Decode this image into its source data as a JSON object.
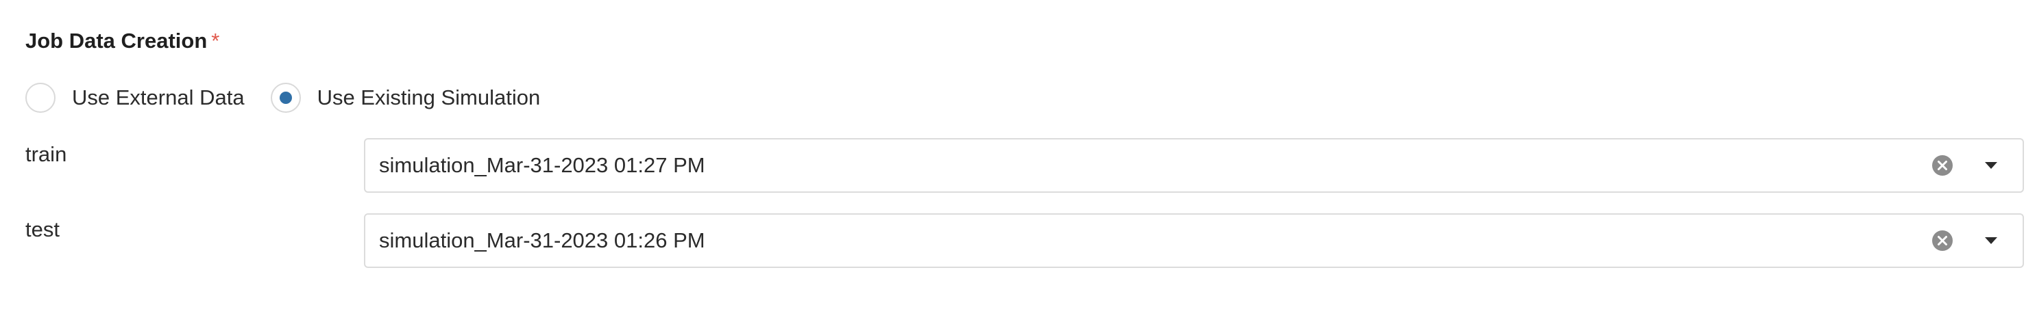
{
  "section": {
    "title": "Job Data Creation",
    "required_mark": "*"
  },
  "data_source": {
    "options": [
      {
        "label": "Use External Data",
        "selected": false
      },
      {
        "label": "Use Existing Simulation",
        "selected": true
      }
    ]
  },
  "fields": {
    "train": {
      "label": "train",
      "value": "simulation_Mar-31-2023 01:27 PM"
    },
    "test": {
      "label": "test",
      "value": "simulation_Mar-31-2023 01:26 PM"
    }
  },
  "colors": {
    "accent": "#2f6fa7",
    "required": "#e0584b",
    "border": "#dcdcdc",
    "icon_gray": "#8c8c8c"
  },
  "icons": {
    "clear": "clear-circle-x-icon",
    "dropdown": "caret-down-icon"
  }
}
